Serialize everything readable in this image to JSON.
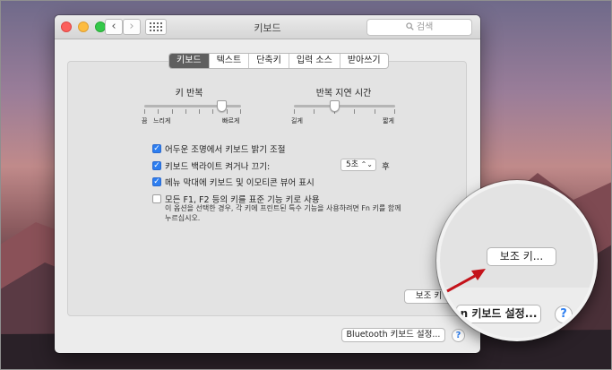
{
  "window": {
    "title": "키보드",
    "search_placeholder": "검색",
    "back": "‹",
    "forward": "›",
    "grid_icon": "grid-icon"
  },
  "tabs": [
    {
      "label": "키보드",
      "active": true
    },
    {
      "label": "텍스트",
      "active": false
    },
    {
      "label": "단축키",
      "active": false
    },
    {
      "label": "입력 소스",
      "active": false
    },
    {
      "label": "받아쓰기",
      "active": false
    }
  ],
  "key_repeat": {
    "title": "키 반복",
    "min_label": "끔",
    "slow_label": "느리게",
    "fast_label": "빠르게",
    "value_fraction": 0.8
  },
  "repeat_delay": {
    "title": "반복 지연 시간",
    "long_label": "길게",
    "short_label": "짧게",
    "value_fraction": 0.4
  },
  "options": [
    {
      "label": "어두운 조명에서 키보드 밝기 조절",
      "checked": true
    },
    {
      "label": "키보드 백라이트 켜거나 끄기:",
      "checked": true
    },
    {
      "label": "메뉴 막대에 키보드 및 이모티콘 뷰어 표시",
      "checked": true
    },
    {
      "label": "모든 F1, F2 등의 키를 표준 기능 키로 사용",
      "checked": false
    }
  ],
  "backlight_timeout": {
    "value": "5초",
    "suffix": "후"
  },
  "fn_description": "이 옵션을 선택한 경우, 각 키에 프린트된 특수 기능을 사용하려면 Fn 키를 함께 누르십시오.",
  "buttons": {
    "modifier_keys": "보조 키...",
    "modifier_keys_cut": "보조 키",
    "bluetooth_setup": "Bluetooth 키보드 설정...",
    "keyboard_setup_partial": "n 키보드 설정...",
    "help": "?"
  },
  "colors": {
    "accent": "#2d7ef0",
    "arrow": "#c4121a"
  }
}
